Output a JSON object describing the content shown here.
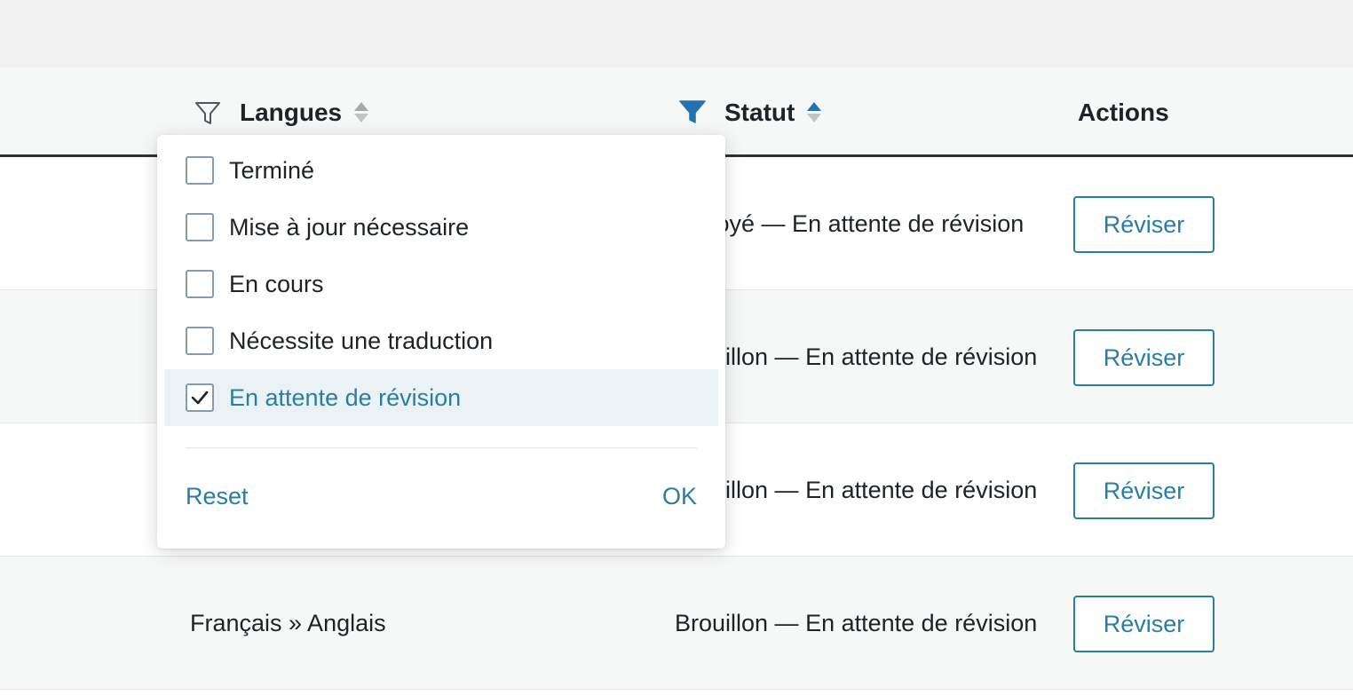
{
  "table": {
    "columns": [
      {
        "label": "Langues",
        "filter_active": false,
        "sort": "none"
      },
      {
        "label": "Statut",
        "filter_active": true,
        "sort": "ascending"
      },
      {
        "label": "Actions"
      }
    ],
    "rows": [
      {
        "language": "",
        "status": "Envoyé — En attente de révision",
        "action": "Réviser"
      },
      {
        "language": "",
        "status": "Brouillon — En attente de révision",
        "action": "Réviser"
      },
      {
        "language": "",
        "status": "Brouillon — En attente de révision",
        "action": "Réviser"
      },
      {
        "language": "Français » Anglais",
        "status": "Brouillon — En attente de révision",
        "action": "Réviser"
      }
    ]
  },
  "status_filter": {
    "options": [
      {
        "label": "Terminé",
        "checked": false
      },
      {
        "label": "Mise à jour nécessaire",
        "checked": false
      },
      {
        "label": "En cours",
        "checked": false
      },
      {
        "label": "Nécessite une traduction",
        "checked": false
      },
      {
        "label": "En attente de révision",
        "checked": true
      }
    ],
    "reset_label": "Reset",
    "ok_label": "OK"
  },
  "colors": {
    "accent": "#2a7ea1",
    "filter_active": "#2271b1",
    "selected_bg": "#eaf2f6",
    "header_border": "#2c3338"
  },
  "icons": {
    "filter_inactive": "filter-outline-icon",
    "filter_active": "filter-filled-icon",
    "checkmark": "checkmark-icon"
  }
}
